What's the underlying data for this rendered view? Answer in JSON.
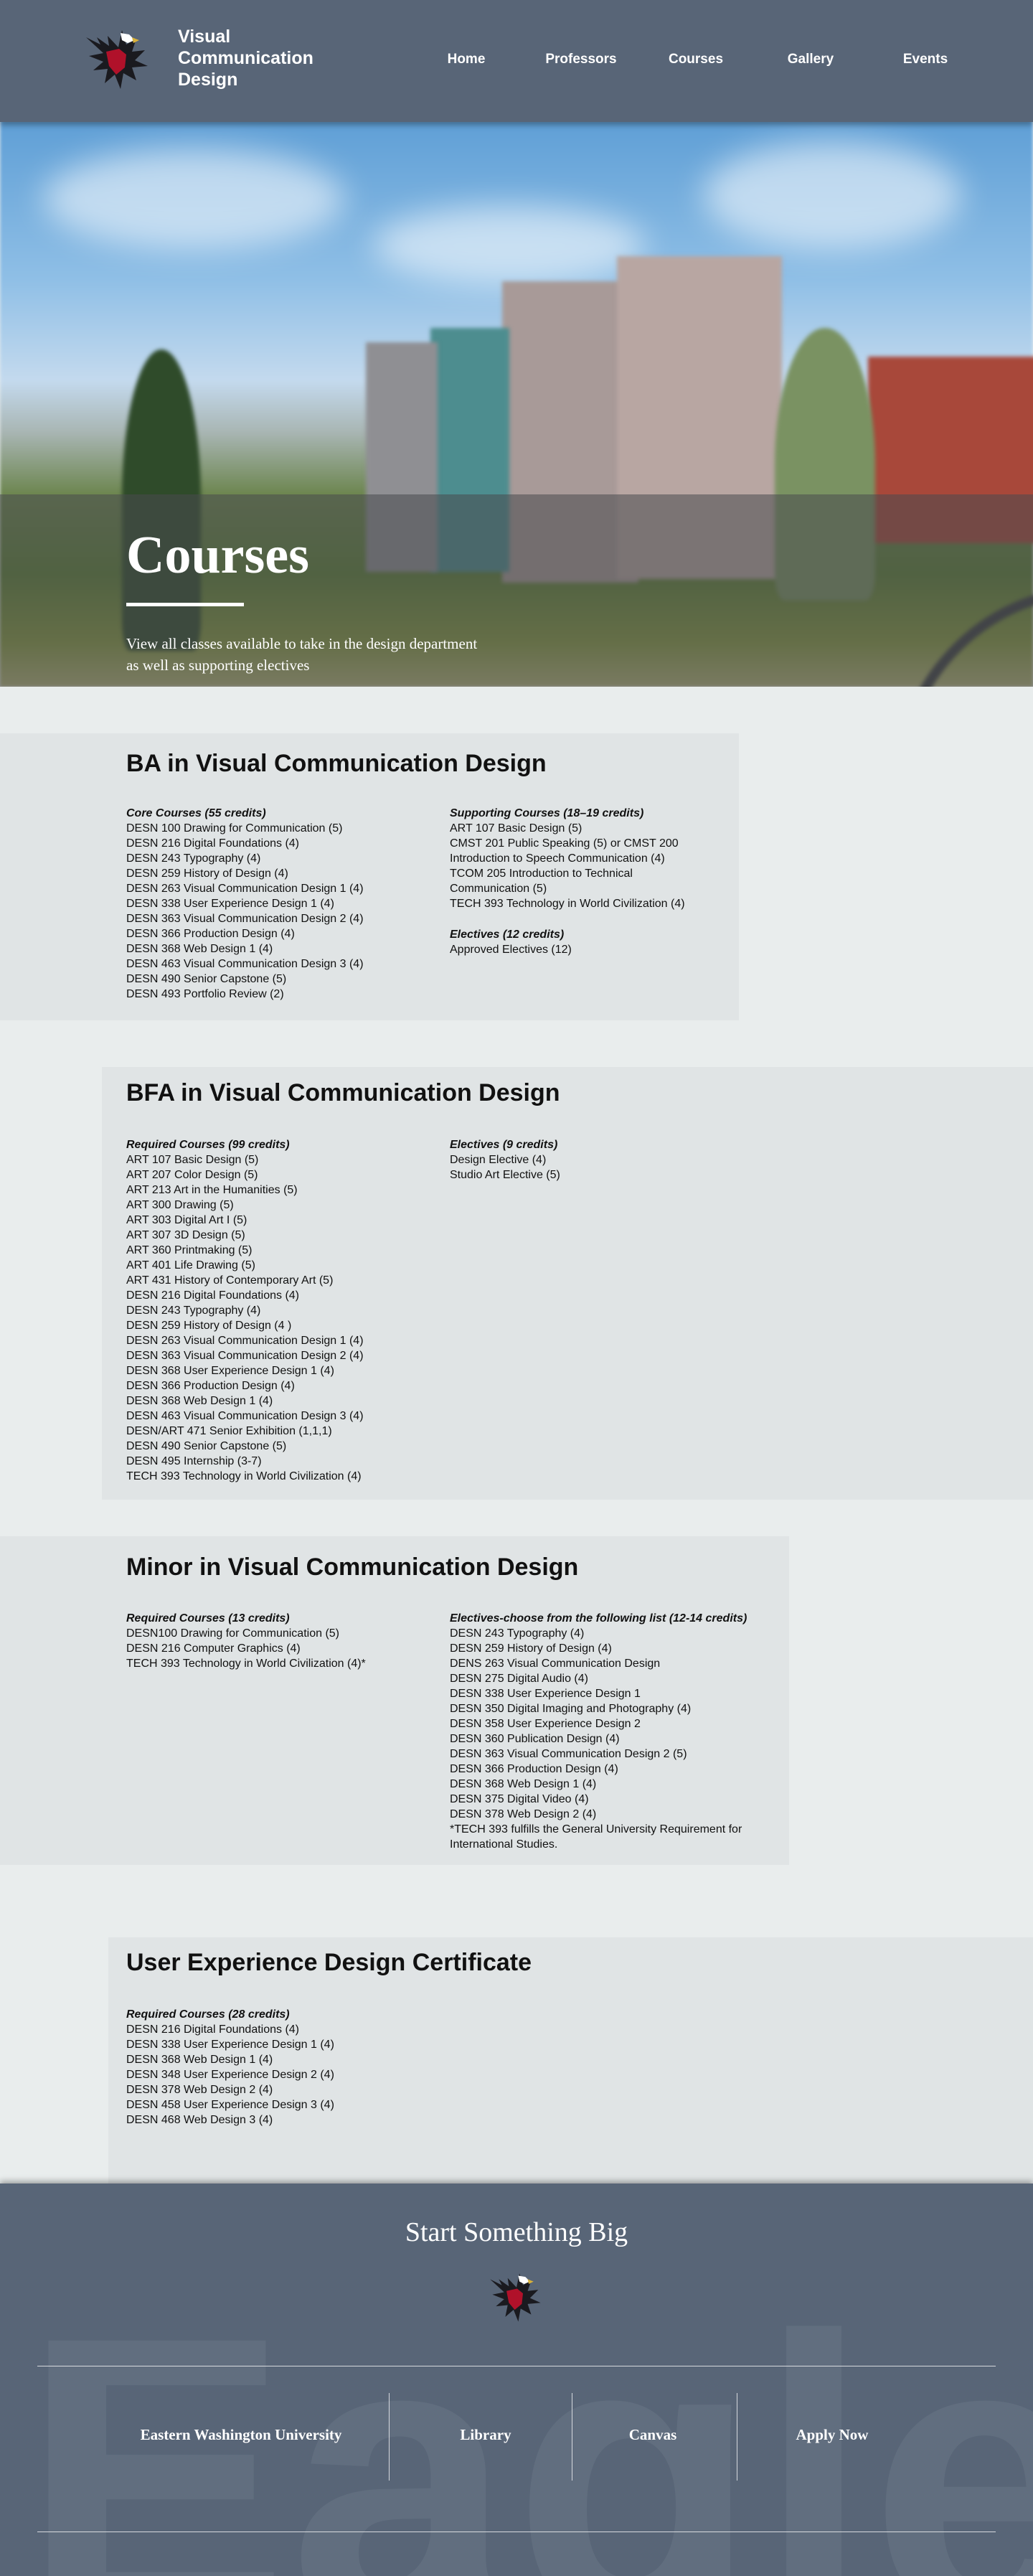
{
  "header": {
    "brand": "Visual Communication Design",
    "nav": [
      "Home",
      "Professors",
      "Courses",
      "Gallery",
      "Events"
    ]
  },
  "hero": {
    "title": "Courses",
    "subtitle": "View all classes available to take in the design department as well as supporting electives"
  },
  "ba": {
    "title": "BA in Visual Communication Design",
    "core_heading": "Core Courses (55 credits)",
    "core": [
      "DESN 100 Drawing for Communication (5)",
      "DESN 216 Digital Foundations (4)",
      "DESN 243 Typography (4)",
      "DESN 259 History of Design (4)",
      "DESN 263 Visual Communication Design 1 (4)",
      "DESN 338 User Experience Design 1 (4)",
      "DESN 363 Visual Communication Design 2 (4)",
      "DESN 366 Production Design (4)",
      "DESN 368 Web Design 1 (4)",
      "DESN 463 Visual Communication Design 3 (4)",
      "DESN 490 Senior Capstone (5)",
      "DESN 493 Portfolio Review (2)"
    ],
    "supporting_heading": "Supporting Courses (18–19 credits)",
    "supporting": [
      "ART 107 Basic Design (5)",
      "CMST 201 Public Speaking (5) or CMST 200 Introduction to Speech Communication (4)",
      "TCOM 205 Introduction to Technical Communication (5)",
      "TECH 393 Technology in World Civilization (4)"
    ],
    "electives_heading": "Electives (12 credits)",
    "electives": [
      "Approved Electives (12)"
    ]
  },
  "bfa": {
    "title": "BFA in Visual Communication Design",
    "required_heading": "Required Courses (99 credits)",
    "required": [
      "ART 107 Basic Design (5)",
      "ART 207 Color Design (5)",
      "ART 213 Art in the Humanities (5)",
      "ART 300 Drawing (5)",
      "ART 303 Digital Art I (5)",
      "ART 307 3D Design (5)",
      "ART 360 Printmaking (5)",
      "ART 401 Life Drawing (5)",
      "ART 431 History of Contemporary Art (5)",
      "DESN 216 Digital Foundations (4)",
      "DESN 243 Typography (4)",
      "DESN 259 History of Design (4 )",
      "DESN 263 Visual Communication Design 1 (4)",
      "DESN 363 Visual Communication Design 2 (4)",
      "DESN 368 User Experience Design 1 (4)",
      "DESN 366 Production Design (4)",
      "DESN 368 Web Design 1 (4)",
      "DESN 463 Visual Communication Design 3 (4)",
      "DESN/ART 471 Senior Exhibition (1,1,1)",
      "DESN 490 Senior Capstone (5)",
      "DESN 495 Internship (3-7)",
      "TECH 393 Technology in World Civilization (4)"
    ],
    "electives_heading": "Electives (9 credits)",
    "electives": [
      "Design Elective (4)",
      "Studio Art Elective (5)"
    ]
  },
  "minor": {
    "title": "Minor in Visual Communication Design",
    "required_heading": "Required Courses (13 credits)",
    "required": [
      "DESN100 Drawing for Communication (5)",
      "DESN 216 Computer Graphics (4)",
      "TECH 393 Technology in World Civilization (4)*"
    ],
    "electives_heading": "Electives-choose from the following list (12-14 credits)",
    "electives": [
      "DESN 243 Typography (4)",
      "DESN 259 History of Design (4)",
      "DENS 263 Visual Communication Design",
      "DESN 275 Digital Audio (4)",
      "DESN 338 User Experience Design 1",
      "DESN 350 Digital Imaging and Photography (4)",
      "DESN 358 User Experience Design 2",
      "DESN 360 Publication Design (4)",
      "DESN 363 Visual Communication Design 2 (5)",
      "DESN 366 Production Design (4)",
      "DESN 368 Web Design 1 (4)",
      "DESN 375 Digital Video (4)",
      "DESN 378 Web Design 2 (4)",
      "*TECH 393 fulfills the General University Requirement for International Studies."
    ]
  },
  "ux": {
    "title": "User Experience Design Certificate",
    "required_heading": "Required Courses (28 credits)",
    "required": [
      "DESN 216 Digital Foundations (4)",
      "DESN 338 User Experience Design 1 (4)",
      "DESN 368 Web Design 1 (4)",
      "DESN 348 User Experience Design 2  (4)",
      "DESN 378 Web Design 2 (4)",
      "DESN 458 User Experience Design 3 (4)",
      "DESN 468 Web Design 3 (4)"
    ]
  },
  "footer": {
    "tagline": "Start Something Big",
    "background_word": "Eagles",
    "links": [
      "Eastern Washington University",
      "Library",
      "Canvas",
      "Apply Now"
    ]
  },
  "colors": {
    "header": "#586577",
    "page_background": "#e9eded",
    "section_background": "#e0e4e5",
    "eagle_red": "#b0112a"
  }
}
